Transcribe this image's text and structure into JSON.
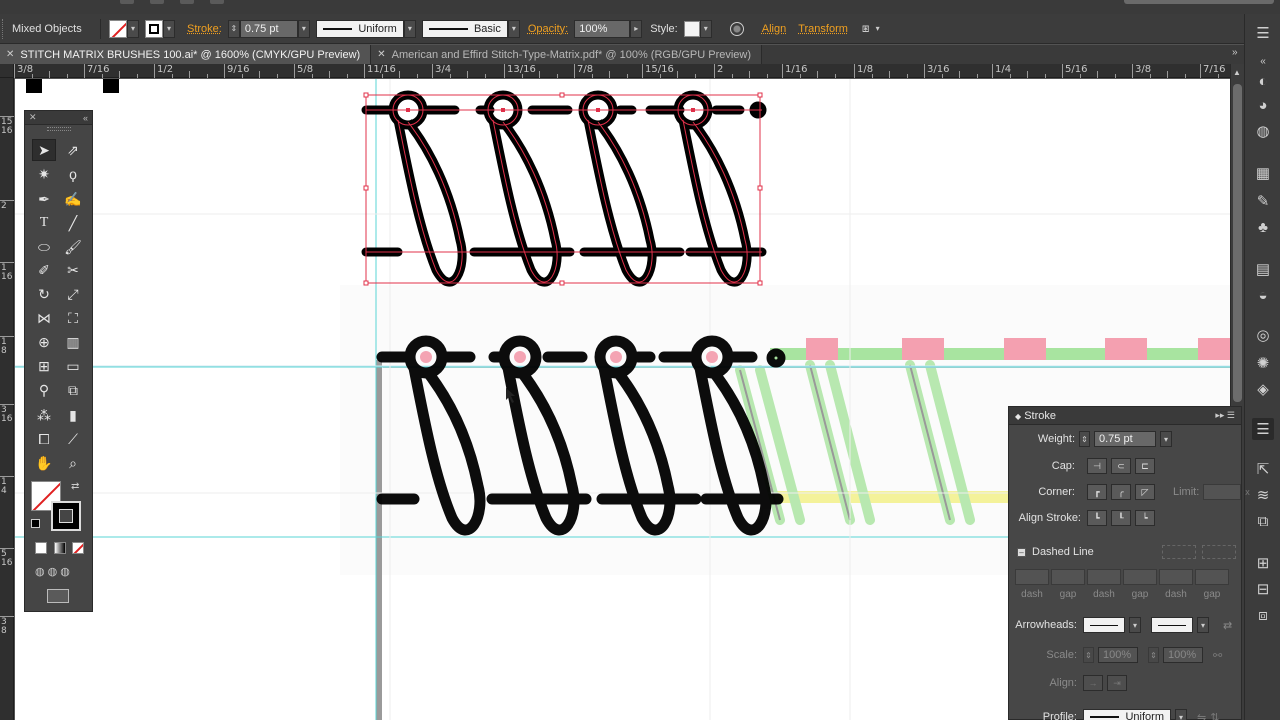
{
  "control_bar": {
    "selection_label": "Mixed Objects",
    "stroke_label": "Stroke:",
    "stroke_weight": "0.75 pt",
    "profile": "Uniform",
    "brush": "Basic",
    "opacity_label": "Opacity:",
    "opacity_value": "100%",
    "style_label": "Style:",
    "align_label": "Align",
    "transform_label": "Transform"
  },
  "tabs": [
    {
      "title": "STITCH MATRIX BRUSHES 100.ai* @ 1600% (CMYK/GPU Preview)",
      "active": true
    },
    {
      "title": "American and Effird Stitch-Type-Matrix.pdf* @ 100% (RGB/GPU Preview)",
      "active": false
    }
  ],
  "ruler": {
    "h_labels": [
      "3/8",
      "7/16",
      "1/2",
      "9/16",
      "5/8",
      "11/16",
      "3/4",
      "13/16",
      "7/8",
      "15/16",
      "2",
      "1/16",
      "1/8",
      "3/16",
      "1/4",
      "5/16",
      "3/8",
      "7/16"
    ],
    "v_labels": [
      "15\n16",
      "2",
      "1\n16",
      "1\n8",
      "3\n16",
      "1\n4",
      "5\n16",
      "3\n8"
    ]
  },
  "stroke_panel": {
    "title": "Stroke",
    "weight_label": "Weight:",
    "weight_value": "0.75 pt",
    "cap_label": "Cap:",
    "corner_label": "Corner:",
    "limit_label": "Limit:",
    "align_label": "Align Stroke:",
    "dashed_label": "Dashed Line",
    "dash_labels": [
      "dash",
      "gap",
      "dash",
      "gap",
      "dash",
      "gap"
    ],
    "arrowheads_label": "Arrowheads:",
    "scale_label": "Scale:",
    "scale_values": [
      "100%",
      "100%"
    ],
    "align_arrow_label": "Align:",
    "profile_label": "Profile:",
    "profile_value": "Uniform"
  },
  "colors": {
    "selection": "#e0304a",
    "guide": "#4fd8d8",
    "accent": "#f0a020"
  }
}
